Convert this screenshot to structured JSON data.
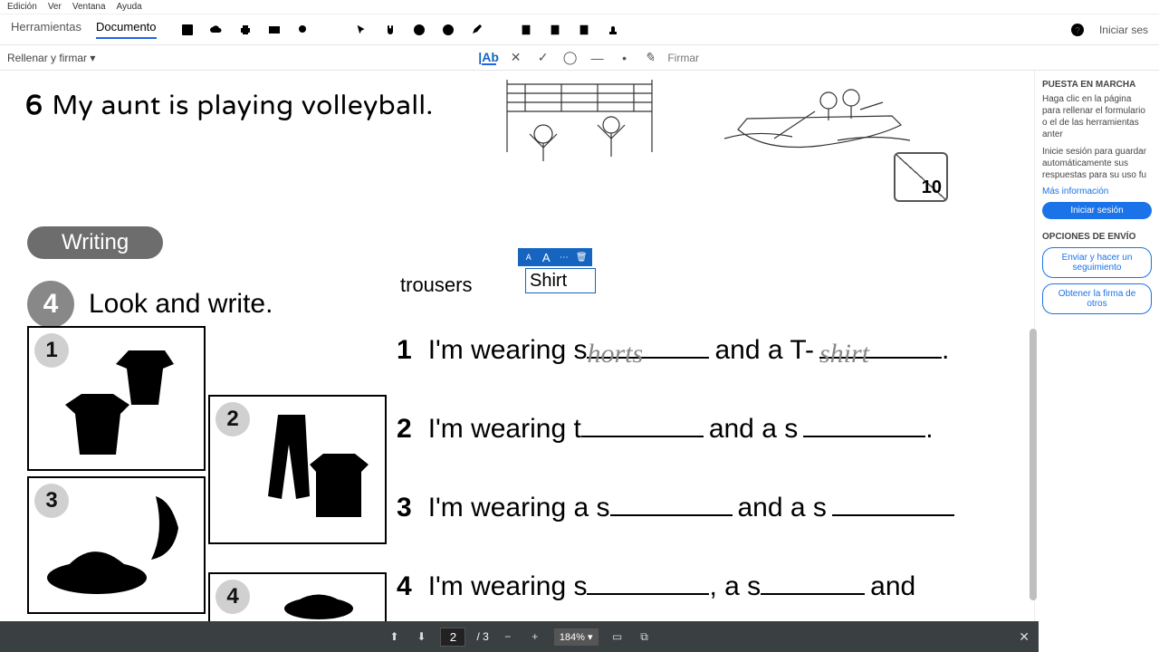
{
  "menubar": [
    "Edición",
    "Ver",
    "Ventana",
    "Ayuda"
  ],
  "tabs": {
    "tools": "Herramientas",
    "document": "Documento"
  },
  "rightTools": {
    "signin": "Iniciar ses"
  },
  "fillbar": {
    "left": "Rellenar y firmar",
    "sign": "Firmar"
  },
  "doc": {
    "sentence6_num": "6",
    "sentence6_text": "My aunt is playing volleyball.",
    "score": "10",
    "writing": "Writing",
    "lookwrite_num": "4",
    "lookwrite_text": "Look and write.",
    "trousers": "trousers",
    "textfield": "Shirt",
    "box1": "1",
    "box2": "2",
    "box3": "3",
    "box4": "4",
    "l1_num": "1",
    "l1_a": "I'm wearing s",
    "l1_h1": "horts",
    "l1_b": " and a T-",
    "l1_h2": "shirt",
    "l1_c": ".",
    "l2_num": "2",
    "l2_a": "I'm wearing t",
    "l2_b": " and a s",
    "l2_c": ".",
    "l3_num": "3",
    "l3_a": "I'm wearing a s",
    "l3_b": " and a s",
    "l4_num": "4",
    "l4_a": "I'm wearing s",
    "l4_b": ", a s",
    "l4_c": " and"
  },
  "side": {
    "h1": "PUESTA EN MARCHA",
    "p1": "Haga clic en la página para rellenar el formulario o el de las herramientas anter",
    "p2": "Inicie sesión para guardar automáticamente sus respuestas para su uso fu",
    "link": "Más información",
    "btn": "Iniciar sesión",
    "h2": "OPCIONES DE ENVÍO",
    "ob1": "Enviar y hacer un seguimiento",
    "ob2": "Obtener la firma de otros"
  },
  "bottom": {
    "page": "2",
    "total": "/ 3",
    "zoom": "184%"
  }
}
